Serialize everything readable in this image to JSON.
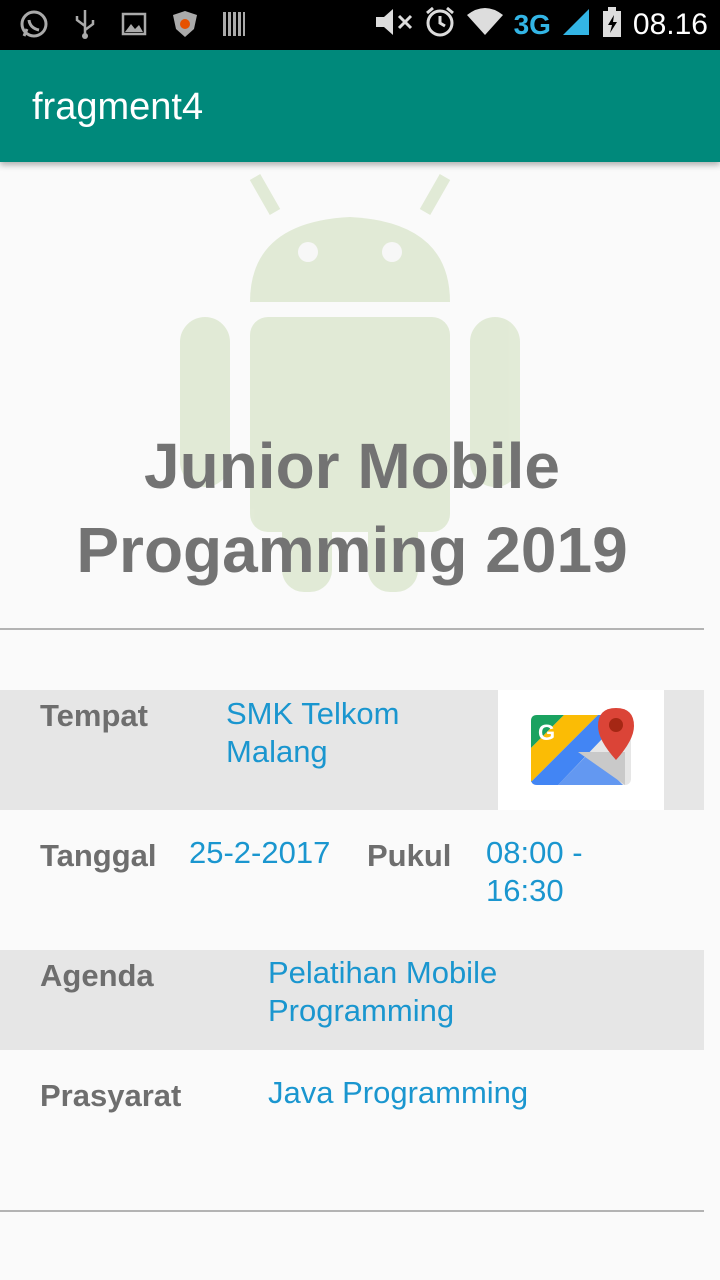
{
  "status_bar": {
    "time": "08.16",
    "network": "3G",
    "icons": [
      "whatsapp-icon",
      "usb-icon",
      "image-icon",
      "shield-icon",
      "barcode-icon",
      "mute-icon",
      "alarm-icon",
      "wifi-icon",
      "signal-icon",
      "battery-icon"
    ]
  },
  "appbar": {
    "title": "fragment4",
    "color": "#00897b"
  },
  "hero": {
    "title_line1": "Junior Mobile",
    "title_line2": "Progamming 2019"
  },
  "details": {
    "tempat_label": "Tempat",
    "tempat_value_line1": "SMK Telkom",
    "tempat_value_line2": "Malang",
    "tanggal_label": "Tanggal",
    "tanggal_value": "25-2-2017",
    "pukul_label": "Pukul",
    "pukul_value_line1": "08:00 -",
    "pukul_value_line2": "16:30",
    "agenda_label": "Agenda",
    "agenda_value_line1": "Pelatihan Mobile",
    "agenda_value_line2": "Programming",
    "prasyarat_label": "Prasyarat",
    "prasyarat_value": "Java Programming"
  },
  "colors": {
    "value_text": "#1a96cf",
    "label_text": "#6e6e6e",
    "shaded_row": "#e6e6e6"
  }
}
